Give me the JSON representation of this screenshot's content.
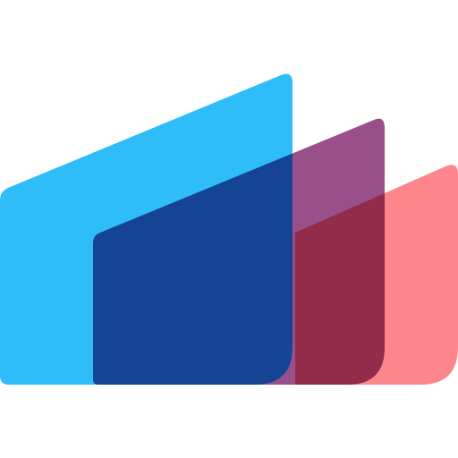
{
  "logo": {
    "name": "layered-building-logo",
    "colors": {
      "back_shape": "#fd868c",
      "middle_shape": "#99508a",
      "front_shape": "#2ebdf9",
      "overlap_dark_red": "#932b4a",
      "overlap_navy": "#154494",
      "background": "#ffffff"
    }
  }
}
